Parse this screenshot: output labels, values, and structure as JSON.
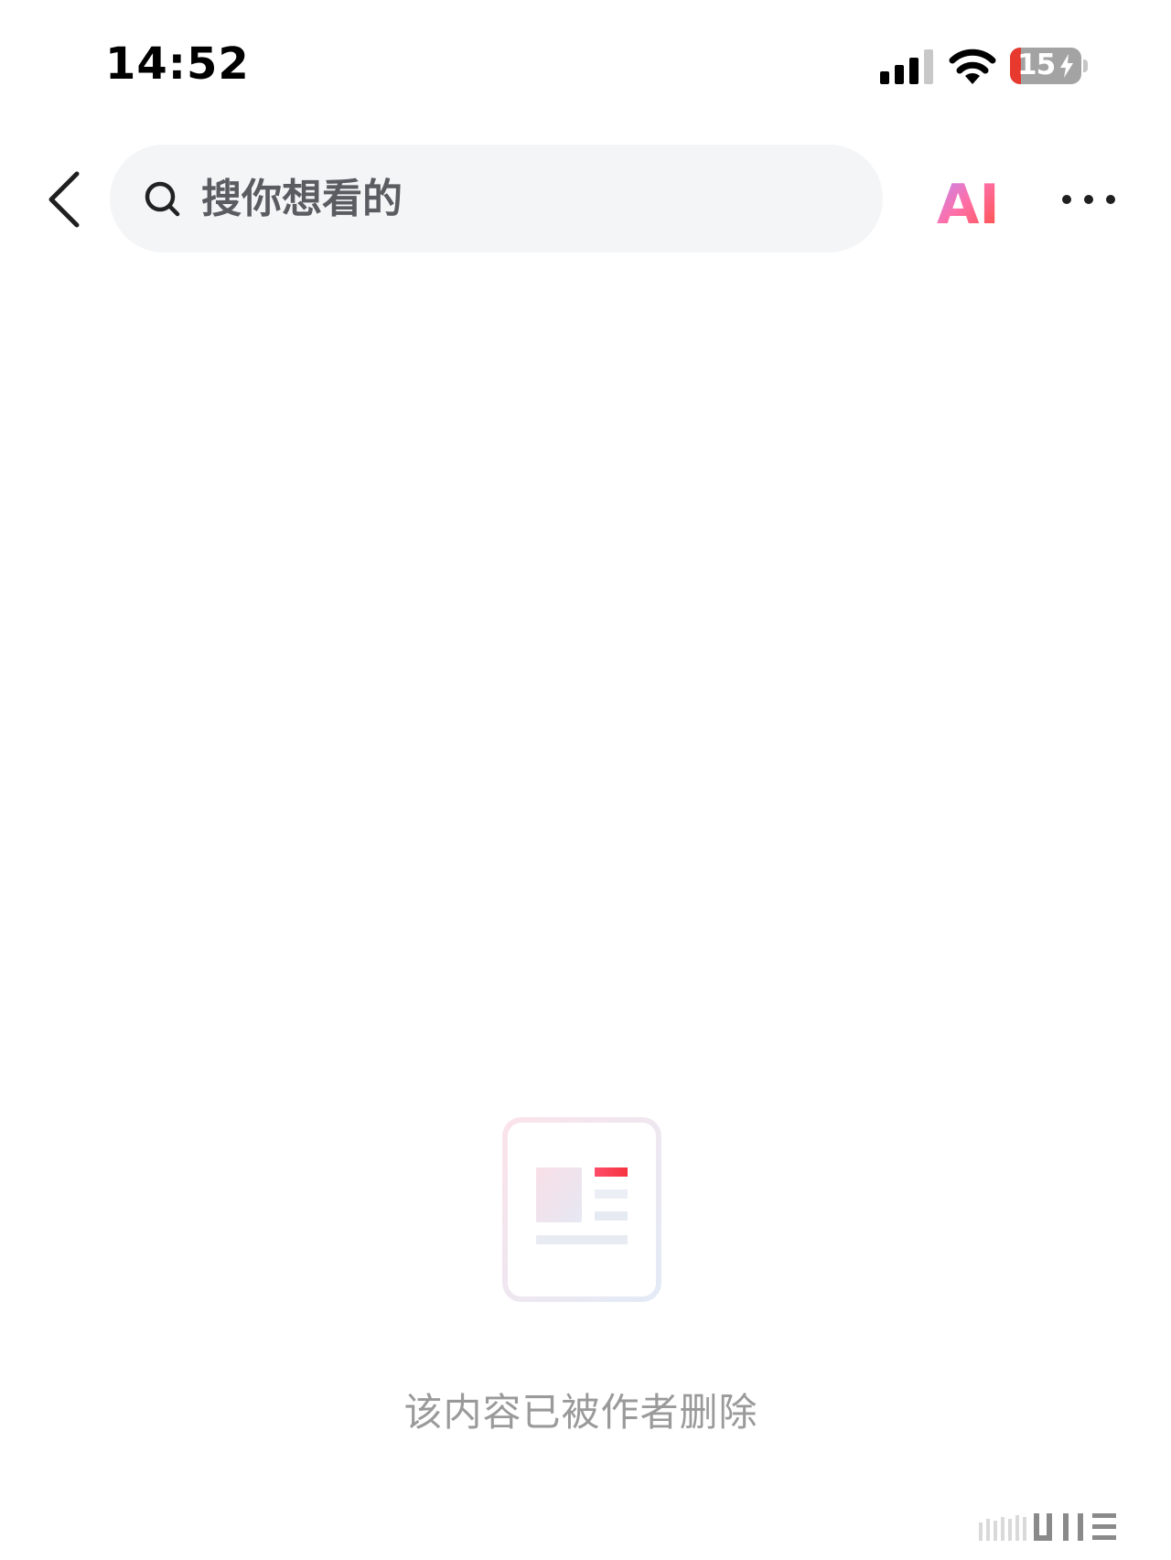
{
  "status_bar": {
    "time": "14:52",
    "battery_level": "15",
    "signal_icon": "cellular-signal-icon",
    "wifi_icon": "wifi-icon",
    "battery_icon": "battery-charging-icon"
  },
  "nav": {
    "back_icon": "chevron-left-icon",
    "search_icon": "search-icon",
    "search_placeholder": "搜你想看的",
    "ai_label": "AI",
    "more_icon": "more-dots-icon"
  },
  "empty_state": {
    "illustration_icon": "deleted-article-icon",
    "message": "该内容已被作者删除"
  },
  "colors": {
    "battery_low": "#e8392f",
    "ai_gradient_start": "#ff6fa8",
    "ai_gradient_end": "#ff4d3a",
    "search_bg": "#f4f5f7",
    "message_text": "#9a9a9a"
  }
}
